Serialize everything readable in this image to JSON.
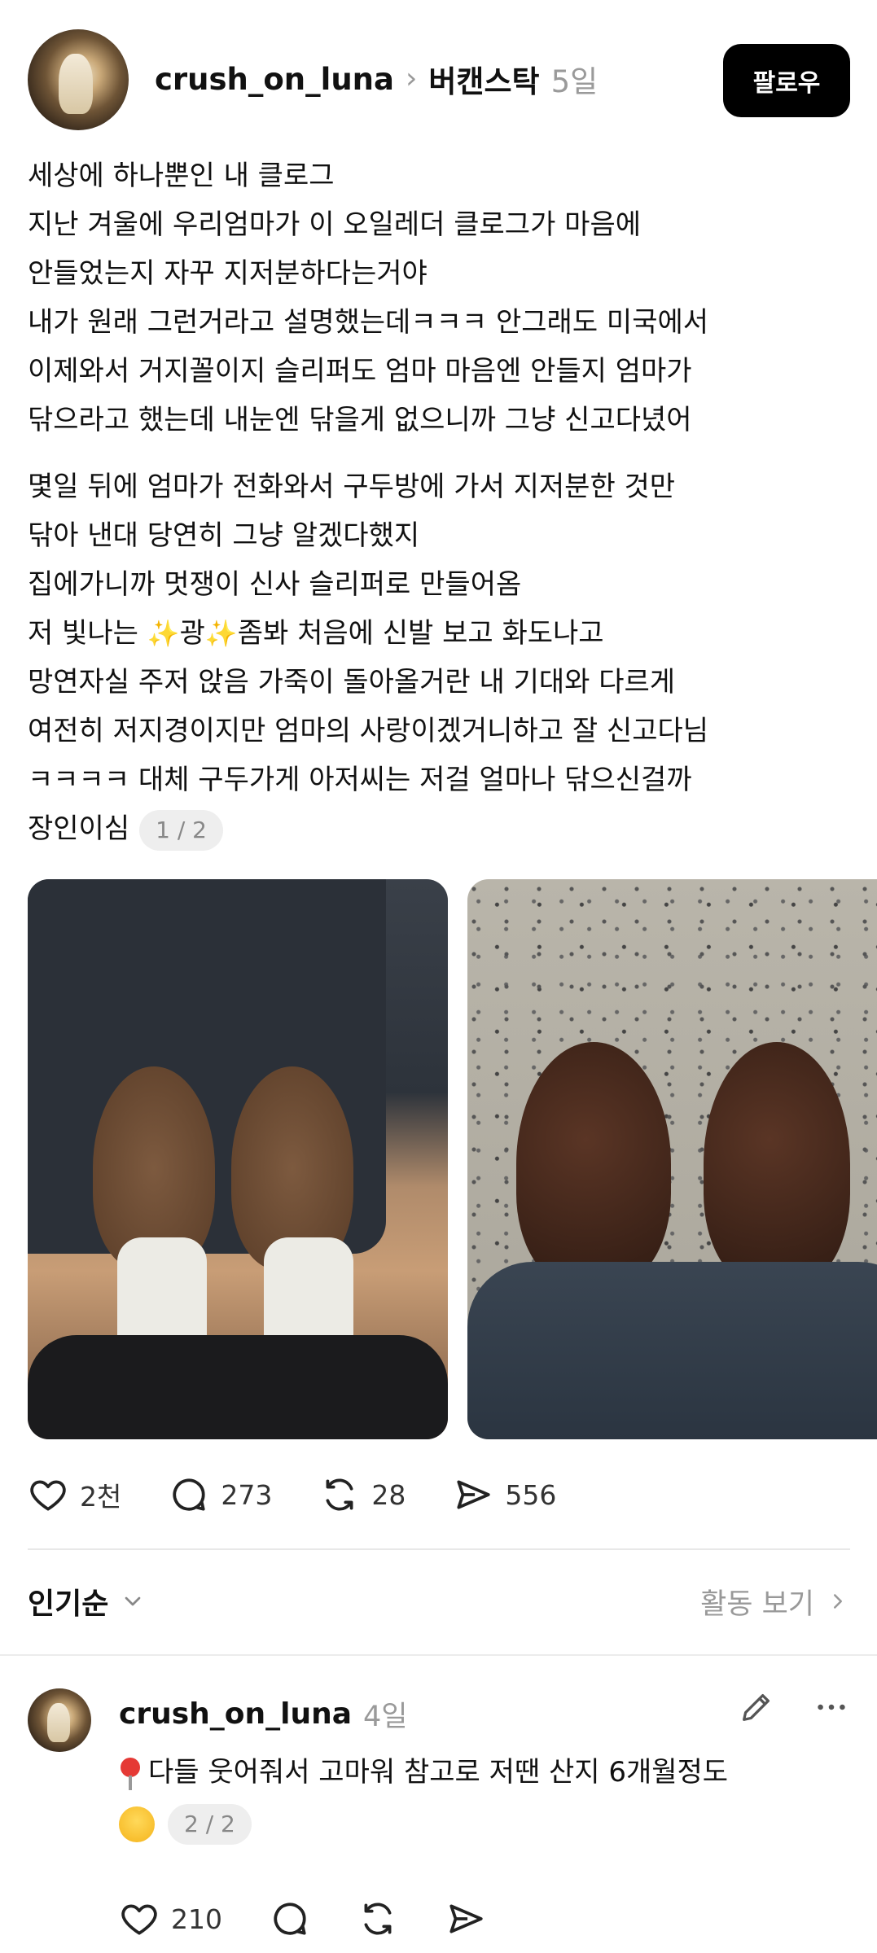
{
  "post": {
    "username": "crush_on_luna",
    "community": "버캔스탁",
    "age": "5일",
    "follow_label": "팔로우",
    "paragraph1": [
      "세상에 하나뿐인 내 클로그",
      "지난 겨울에 우리엄마가 이 오일레더 클로그가 마음에",
      "안들었는지 자꾸 지저분하다는거야",
      "내가 원래 그런거라고 설명했는데ㅋㅋㅋ 안그래도 미국에서",
      "이제와서 거지꼴이지 슬리퍼도 엄마 마음엔 안들지 엄마가",
      "닦으라고 했는데 내눈엔 닦을게 없으니까 그냥 신고다녔어"
    ],
    "paragraph2": {
      "line1": "몇일 뒤에 엄마가 전화와서 구두방에 가서 지저분한 것만",
      "line2": "닦아 낸대 당연히 그냥 알겠다했지",
      "line3": "집에가니까 멋쟁이 신사 슬리퍼로 만들어옴",
      "line4_a": "저 빛나는 ",
      "sparkle": "✨",
      "line4_b": "광",
      "line4_c": "좀봐 처음에 신발 보고 화도나고",
      "line5": "망연자실 주저 앉음 가죽이 돌아올거란 내 기대와 다르게",
      "line6": "여전히 저지경이지만 엄마의 사랑이겠거니하고 잘 신고다님",
      "line7": "ㅋㅋㅋㅋ 대체 구두가게 아저씨는 저걸 얼마나 닦으신걸까",
      "line8": "장인이심"
    },
    "page_indicator": "1 / 2",
    "stats": {
      "likes": "2천",
      "comments": "273",
      "reposts": "28",
      "shares": "556"
    }
  },
  "sort": {
    "label": "인기순",
    "activity_label": "활동 보기"
  },
  "reply": {
    "username": "crush_on_luna",
    "age": "4일",
    "text": "다들 웃어줘서 고마워 참고로 저땐 산지 6개월정도",
    "page_indicator": "2 / 2",
    "likes": "210"
  }
}
